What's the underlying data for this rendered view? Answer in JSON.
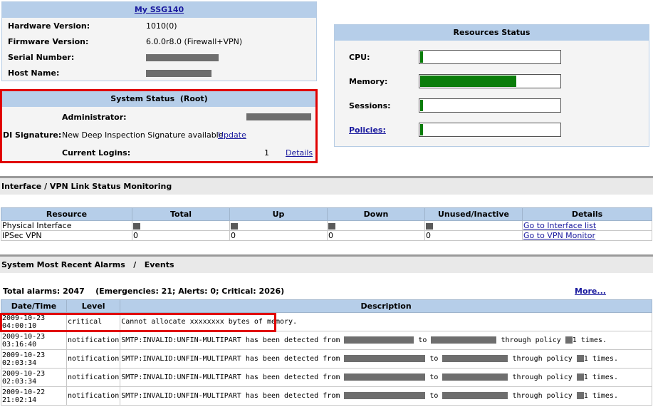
{
  "device": {
    "title": "My SSG140",
    "rows": [
      {
        "label": "Hardware Version:",
        "value": "1010(0)"
      },
      {
        "label": "Firmware Version:",
        "value": "6.0.0r8.0 (Firewall+VPN)"
      },
      {
        "label": "Serial Number:",
        "value": ""
      },
      {
        "label": "Host Name:",
        "value": ""
      }
    ]
  },
  "system_status": {
    "title": "System Status  (Root)",
    "admin_label": "Administrator:",
    "di_label": "DI Signature:",
    "di_text": "New Deep Inspection Signature available",
    "update_link": "Update",
    "logins_label": "Current Logins:",
    "logins_count": "1",
    "details_link": "Details"
  },
  "resources": {
    "title": "Resources Status",
    "items": [
      {
        "label": "CPU:",
        "level": 0.02
      },
      {
        "label": "Memory:",
        "level": 0.69
      },
      {
        "label": "Sessions:",
        "level": 0.02
      },
      {
        "label": "Policies:",
        "level": 0.02,
        "link": true
      }
    ]
  },
  "interface_section": {
    "title": "Interface / VPN Link Status Monitoring",
    "columns": [
      "Resource",
      "Total",
      "Up",
      "Down",
      "Unused/Inactive",
      "Details"
    ],
    "rows": [
      {
        "resource": "Physical Interface",
        "link": "Go to Interface list"
      },
      {
        "resource": "IPSec VPN",
        "total": "0",
        "up": "0",
        "down": "0",
        "unused": "0",
        "link": "Go to VPN Monitor"
      }
    ]
  },
  "alarms": {
    "section_title": "System Most Recent Alarms   /   Events",
    "summary": "Total alarms: 2047    (Emergencies: 21; Alerts: 0; Critical: 2026)",
    "more_link": "More...",
    "columns": [
      "Date/Time",
      "Level",
      "Description"
    ],
    "rows": [
      {
        "date": "2009-10-23",
        "time": "04:00:10",
        "level": "critical",
        "desc": "Cannot allocate xxxxxxxx bytes of memory."
      },
      {
        "date": "2009-10-23",
        "time": "03:16:40",
        "level": "notification",
        "desc_a": "SMTP:INVALID:UNFIN-MULTIPART has been detected from",
        "to": "to",
        "via": "through policy",
        "times": "1 times."
      },
      {
        "date": "2009-10-23",
        "time": "02:03:34",
        "level": "notification",
        "desc_a": "SMTP:INVALID:UNFIN-MULTIPART has been detected from",
        "to": "to",
        "via": "through policy",
        "times": "1 times."
      },
      {
        "date": "2009-10-23",
        "time": "02:03:34",
        "level": "notification",
        "desc_a": "SMTP:INVALID:UNFIN-MULTIPART has been detected from",
        "to": "to",
        "via": "through policy",
        "times": "1 times."
      },
      {
        "date": "2009-10-22",
        "time": "21:02:14",
        "level": "notification",
        "desc_a": "SMTP:INVALID:UNFIN-MULTIPART has been detected from",
        "to": "to",
        "via": "through policy",
        "times": "1 times."
      }
    ]
  },
  "colors": {
    "header_blue": "#b6cee9",
    "bar_green": "#0a7d0a",
    "highlight_red": "#e00000"
  }
}
